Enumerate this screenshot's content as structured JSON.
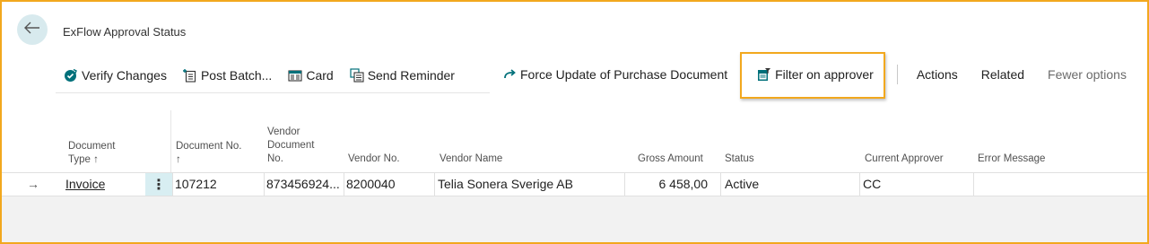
{
  "page": {
    "title": "ExFlow Approval Status"
  },
  "toolbar": {
    "verify_changes": "Verify Changes",
    "post_batch": "Post Batch...",
    "card": "Card",
    "send_reminder": "Send Reminder",
    "force_update": "Force Update of Purchase Document",
    "filter_on_approver": "Filter on approver",
    "actions": "Actions",
    "related": "Related",
    "fewer_options": "Fewer options"
  },
  "icons": {
    "back": "arrow-left-icon",
    "verify": "check-badge-icon",
    "post_batch": "post-batch-icon",
    "card": "card-icon",
    "send_reminder": "send-reminder-icon",
    "force_update": "redo-arrow-icon",
    "filter": "filter-approver-icon"
  },
  "colors": {
    "accent": "#00707a",
    "highlight_border": "#f2a81e",
    "back_button_bg": "#d8eaee",
    "row_menu_bg": "#d8eef2"
  },
  "grid": {
    "headers": {
      "document_type_line1": "Document",
      "document_type_line2": "Type ↑",
      "document_no_line1": "Document No.",
      "document_no_line2": "↑",
      "vendor_document_no_line1": "Vendor",
      "vendor_document_no_line2": "Document",
      "vendor_document_no_line3": "No.",
      "vendor_no": "Vendor No.",
      "vendor_name": "Vendor Name",
      "gross_amount": "Gross Amount",
      "status": "Status",
      "current_approver": "Current Approver",
      "error_message": "Error Message"
    },
    "rows": [
      {
        "indicator": "→",
        "document_type": "Invoice",
        "menu": "⋮",
        "document_no": "107212",
        "vendor_document_no": "873456924...",
        "vendor_no": "8200040",
        "vendor_name": "Telia Sonera Sverige AB",
        "gross_amount": "6 458,00",
        "status": "Active",
        "current_approver": "CC",
        "error_message": ""
      }
    ]
  }
}
